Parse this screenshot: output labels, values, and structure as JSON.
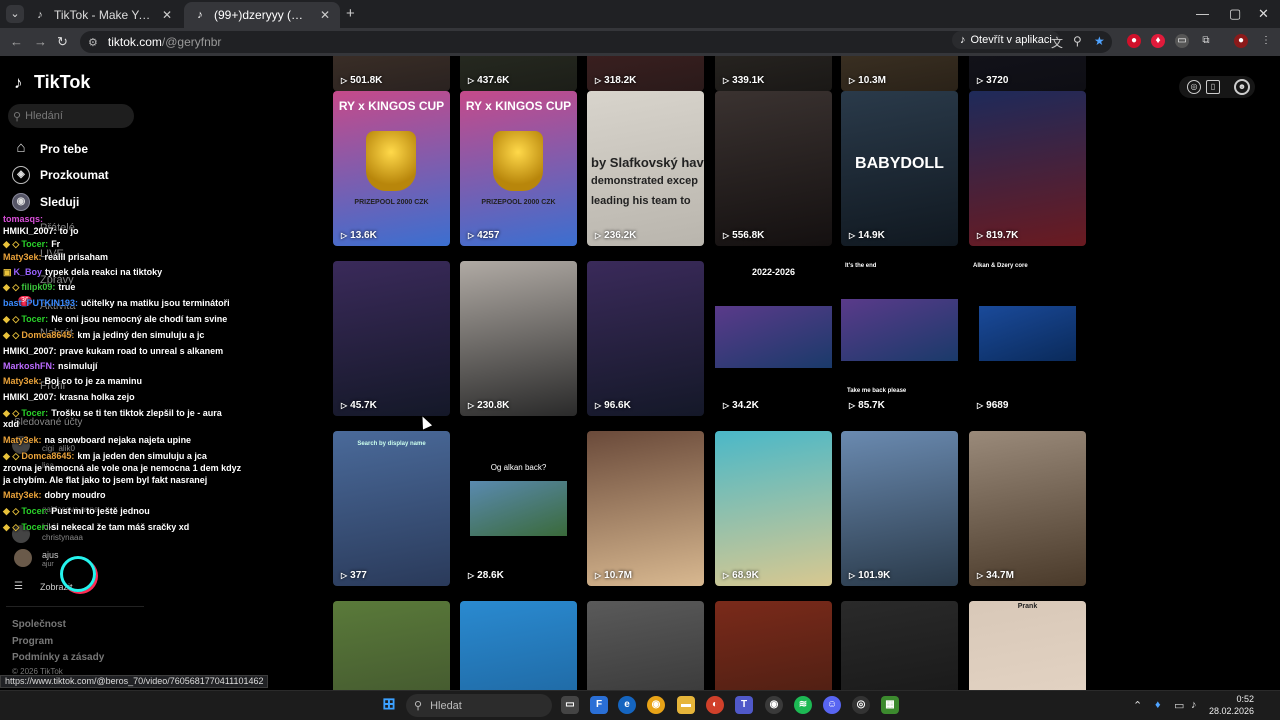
{
  "browser": {
    "tabs": [
      {
        "title": "TikTok - Make Your Day",
        "active": false
      },
      {
        "title": "(99+)dzeryyy (@geryfnbr) | TikTok",
        "active": true
      }
    ],
    "new_tab_label": "+",
    "url_host": "tiktok.com",
    "url_path": "/@geryfnbr",
    "open_in_app_label": "Otevřít v aplikaci",
    "window_controls": [
      "—",
      "▢",
      "✕"
    ]
  },
  "sidebar": {
    "logo": "TikTok",
    "search_placeholder": "Hledání",
    "nav": [
      {
        "label": "Pro tebe",
        "icon": "home-icon"
      },
      {
        "label": "Prozkoumat",
        "icon": "compass-icon"
      },
      {
        "label": "Sleduji",
        "icon": "following-icon"
      }
    ],
    "faded": {
      "friends": "Přátelé",
      "live": "LIVE",
      "messages": "Zprávy",
      "activity": "Aktivita",
      "activity_badge": "36",
      "upload": "Nahrát",
      "profile": "Profil",
      "following_accounts": "Sledované účty",
      "more": "Zobrazit"
    },
    "suggested": [
      {
        "name": "cigi_alik0"
      },
      {
        "name": "lisa"
      },
      {
        "name": "gajdosova.anna"
      },
      {
        "name": "kiki"
      },
      {
        "name": "christynaaa"
      },
      {
        "name": "ajus",
        "sub": "ajur"
      }
    ],
    "footer": [
      "Společnost",
      "Program",
      "Podmínky a zásady",
      "© 2026 TikTok"
    ]
  },
  "chat": [
    {
      "name": "tomasqs:",
      "color": "#d94fd9",
      "text": ""
    },
    {
      "name": "HMIKI_2007:",
      "color": "#ffffff",
      "text": "to jo"
    },
    {
      "name": "Tocer:",
      "color": "#2ad12a",
      "text": "Fr",
      "badges": "◆ ◇"
    },
    {
      "name": "Maty3ek:",
      "color": "#e9a23a",
      "text": "reálll prisaham"
    },
    {
      "name": "K_Boy",
      "color": "#9a62ff",
      "text": "typek dela reakci na tiktoky",
      "badges": "▣"
    },
    {
      "name": "filipk09:",
      "color": "#3ac23a",
      "text": "true",
      "badges": "◆ ◇"
    },
    {
      "name": "bast_PUTKIN193:",
      "color": "#3a8bff",
      "text": "učitelky na matiku jsou terminátoři"
    },
    {
      "name": "Tocer:",
      "color": "#2ad12a",
      "text": "Ne oni jsou nemocný ale chodí tam svine",
      "badges": "◆ ◇"
    },
    {
      "name": "Domca8645:",
      "color": "#e9a23a",
      "text": "km ja jediný den simuluju a jc",
      "badges": "◆ ◇"
    },
    {
      "name": "HMIKI_2007:",
      "color": "#ffffff",
      "text": "prave kukam road to unreal s alkanem"
    },
    {
      "name": "MarkoshFN:",
      "color": "#bb6bff",
      "text": "nsimulují"
    },
    {
      "name": "Maty3ek:",
      "color": "#e9a23a",
      "text": "Boj co to je za maminu"
    },
    {
      "name": "HMIKI_2007:",
      "color": "#ffffff",
      "text": "krasna holka zejo"
    },
    {
      "name": "Tocer:",
      "color": "#2ad12a",
      "text": "Trošku se ti ten tiktok zlepšil to je - aura",
      "badges": "◆ ◇"
    },
    {
      "name": "",
      "color": "#ffffff",
      "text": "xdd"
    },
    {
      "name": "Maty3ek:",
      "color": "#e9a23a",
      "text": "na snowboard nejaka najeta upine"
    },
    {
      "name": "Domca8645:",
      "color": "#e9a23a",
      "text": "km ja jeden den simuluju a jca",
      "badges": "◆ ◇"
    },
    {
      "name": "",
      "color": "#ffffff",
      "text": "zrovna je nemocná ale vole ona je nemocna 1 dem kdyz"
    },
    {
      "name": "",
      "color": "#ffffff",
      "text": "ja chybím. Ale flat jako to jsem byl fakt nasranej"
    },
    {
      "name": "Maty3ek:",
      "color": "#e9a23a",
      "text": "dobry moudro"
    },
    {
      "name": "Tocer:",
      "color": "#2ad12a",
      "text": "Pust mi to ještě jednou",
      "badges": "◆ ◇"
    },
    {
      "name": "Tocer:",
      "color": "#2ad12a",
      "text": "si nekecal že tam máš sračky xd",
      "badges": "◆ ◇"
    }
  ],
  "videos": [
    {
      "views": "501.8K"
    },
    {
      "views": "437.6K"
    },
    {
      "views": "318.2K"
    },
    {
      "views": "339.1K"
    },
    {
      "views": "10.3M"
    },
    {
      "views": "3720"
    },
    {
      "views": "13.6K",
      "overlay": "RY x KINGOS CUP",
      "sub": "PRIZEPOOL 2000 CZK"
    },
    {
      "views": "4257",
      "overlay": "RY x KINGOS CUP",
      "sub": "PRIZEPOOL 2000 CZK"
    },
    {
      "views": "236.2K",
      "overlay": "by Slafkovský hav",
      "sub": "demonstrated excep",
      "sub2": "leading his team to"
    },
    {
      "views": "556.8K"
    },
    {
      "views": "14.9K",
      "overlay": "BABYDOLL"
    },
    {
      "views": "819.7K"
    },
    {
      "views": "45.7K"
    },
    {
      "views": "230.8K"
    },
    {
      "views": "96.6K"
    },
    {
      "views": "34.2K",
      "overlay": "2022-2026"
    },
    {
      "views": "85.7K",
      "overlay": "It's the end",
      "sub": "Take me back please"
    },
    {
      "views": "9689",
      "overlay": "Alkan & Dzery core"
    },
    {
      "views": "377",
      "overlay": "Search by display name"
    },
    {
      "views": "28.6K",
      "overlay": "Og alkan back?"
    },
    {
      "views": "10.7M"
    },
    {
      "views": "68.9K"
    },
    {
      "views": "101.9K"
    },
    {
      "views": "34.7M"
    },
    {
      "views": ""
    },
    {
      "views": ""
    },
    {
      "views": ""
    },
    {
      "views": ""
    },
    {
      "views": ""
    },
    {
      "views": "",
      "overlay": "Prank"
    }
  ],
  "status_link": "https://www.tiktok.com/@beros_70/video/7605681770411101462",
  "taskbar": {
    "search_placeholder": "Hledat",
    "time": "0:52",
    "date": "28.02.2026"
  }
}
